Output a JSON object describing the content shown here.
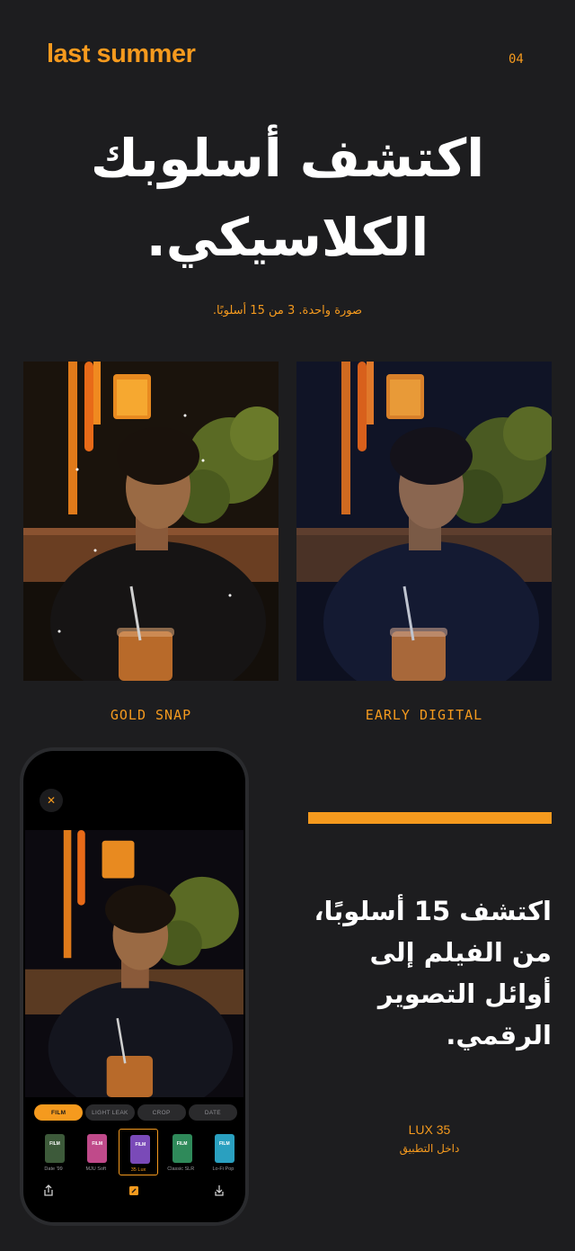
{
  "header": {
    "brand": "last summer",
    "page_number": "04"
  },
  "hero": {
    "headline": "اكتشف أسلوبك الكلاسيكي.",
    "subline": "صورة واحدة. 3 من 15 أسلوبًا."
  },
  "comparison": [
    {
      "label": "GOLD SNAP"
    },
    {
      "label": "EARLY DIGITAL"
    }
  ],
  "phone": {
    "close_icon": "close-icon",
    "tabs": [
      {
        "label": "FILM",
        "active": true
      },
      {
        "label": "LIGHT LEAK",
        "active": false
      },
      {
        "label": "CROP",
        "active": false
      },
      {
        "label": "DATE",
        "active": false
      }
    ],
    "films": [
      {
        "name": "Date '99",
        "color": "#3d5a3a",
        "active": false
      },
      {
        "name": "MJU Soft",
        "color": "#c04a8a",
        "active": false
      },
      {
        "name": "35 Lux",
        "color": "#7a4ab8",
        "active": true
      },
      {
        "name": "Classic SLR",
        "color": "#2f8a5a",
        "active": false
      },
      {
        "name": "Lo-Fi Pop",
        "color": "#2aa0c0",
        "active": false
      }
    ],
    "bottom_icons": [
      "share-icon",
      "edit-icon",
      "download-icon"
    ]
  },
  "feature": {
    "text": "اكتشف 15 أسلوبًا، من الفيلم إلى أوائل التصوير الرقمي.",
    "style_name": "LUX 35",
    "style_sub": "داخل التطبيق"
  },
  "colors": {
    "accent": "#f59a1e",
    "background": "#1d1d1f"
  }
}
